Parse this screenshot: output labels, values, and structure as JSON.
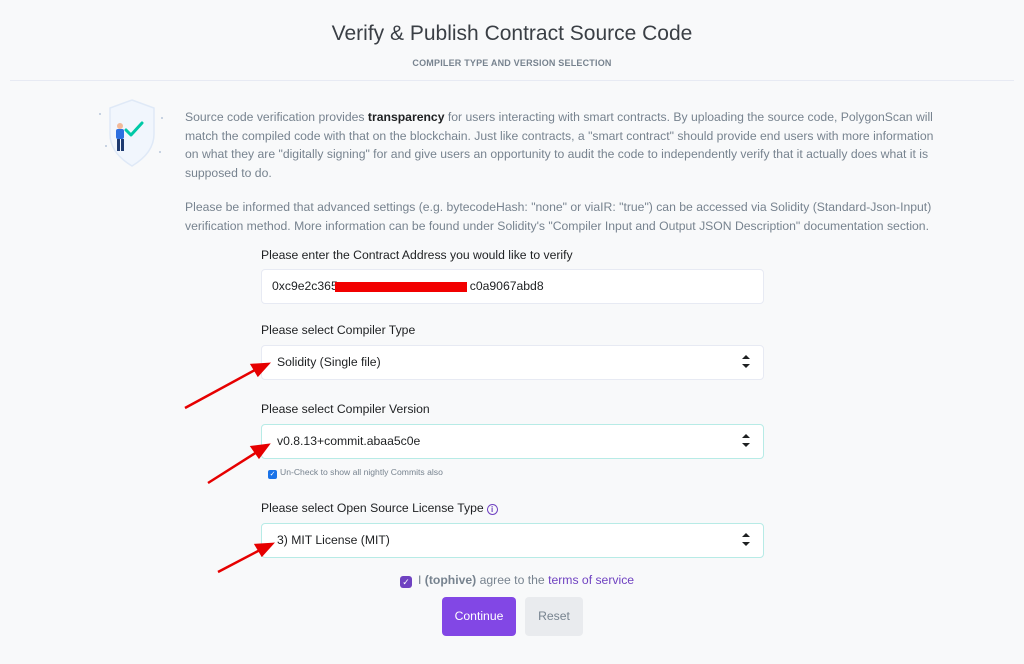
{
  "header": {
    "title": "Verify & Publish Contract Source Code",
    "subtitle": "COMPILER TYPE AND VERSION SELECTION"
  },
  "intro": {
    "p1_before": "Source code verification provides ",
    "p1_bold": "transparency",
    "p1_after": " for users interacting with smart contracts. By uploading the source code, PolygonScan will match the compiled code with that on the blockchain. Just like contracts, a \"smart contract\" should provide end users with more information on what they are \"digitally signing\" for and give users an opportunity to audit the code to independently verify that it actually does what it is supposed to do.",
    "p2": "Please be informed that advanced settings (e.g. bytecodeHash: \"none\" or viaIR: \"true\") can be accessed via Solidity (Standard-Json-Input) verification method. More information can be found under Solidity's \"Compiler Input and Output JSON Description\" documentation section."
  },
  "form": {
    "address_label": "Please enter the Contract Address you would like to verify",
    "address_prefix": "0xc9e2c365",
    "address_suffix": "c0a9067abd8",
    "compiler_type_label": "Please select Compiler Type",
    "compiler_type_value": "Solidity (Single file)",
    "compiler_version_label": "Please select Compiler Version",
    "compiler_version_value": "v0.8.13+commit.abaa5c0e",
    "nightly_label": "Un-Check to show all nightly Commits also",
    "license_label": "Please select Open Source License Type",
    "license_value": "3) MIT License (MIT)",
    "agree_prefix": "I ",
    "agree_user": "(tophive)",
    "agree_middle": " agree to the ",
    "agree_link": "terms of service",
    "continue_label": "Continue",
    "reset_label": "Reset"
  },
  "icons": {
    "chevron": "sort-chevrons-icon",
    "info": "info-circle-icon",
    "check": "checkmark-icon"
  },
  "colors": {
    "accent": "#8247e5",
    "link": "#6f42c1",
    "annotation_arrow": "#e60000",
    "redaction": "#f20000"
  }
}
